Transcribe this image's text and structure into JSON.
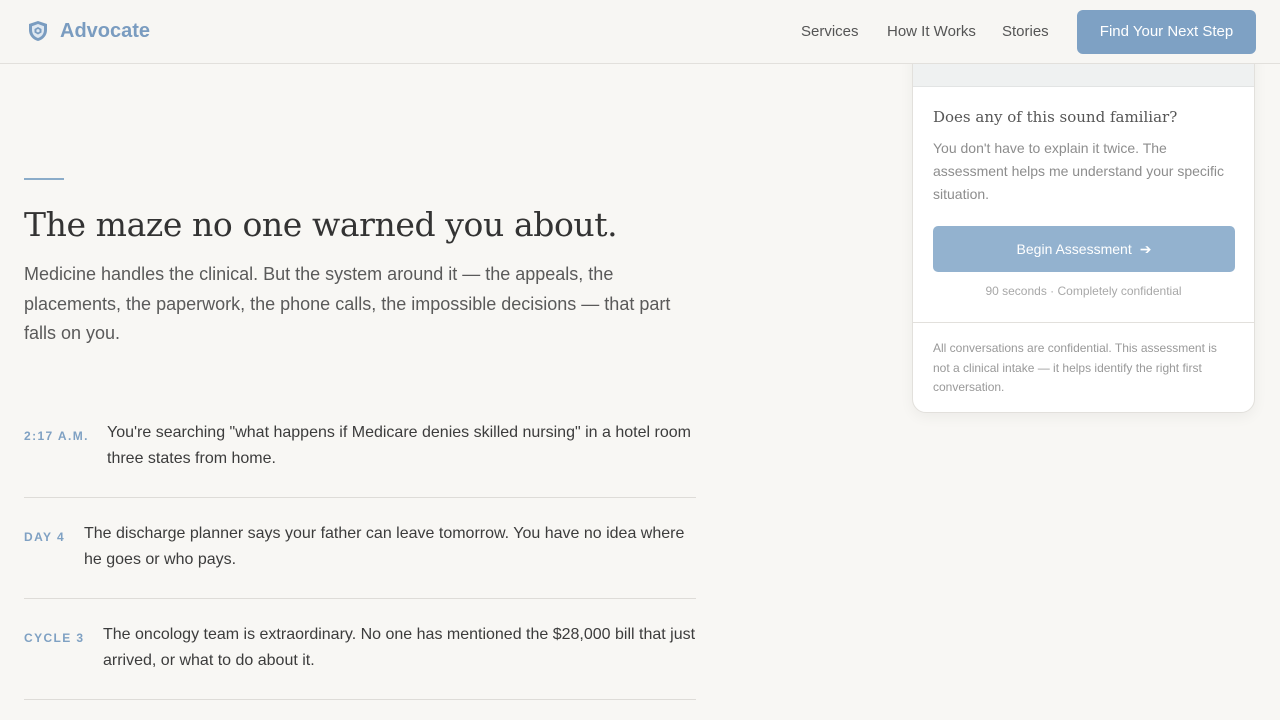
{
  "header": {
    "brand": "Advocate",
    "nav": [
      "Services",
      "How It Works",
      "Stories"
    ],
    "cta": "Find Your Next Step"
  },
  "hero": {
    "title": "The maze no one warned you about.",
    "subtitle": "Medicine handles the clinical. But the system around it — the appeals, the placements, the paperwork, the phone calls, the impossible decisions — that part falls on you."
  },
  "stories": [
    {
      "label": "2:17 A.M.",
      "text": "You're searching \"what happens if Medicare denies skilled nursing\" in a hotel room three states from home."
    },
    {
      "label": "DAY 4",
      "text": "The discharge planner says your father can leave tomorrow. You have no idea where he goes or who pays."
    },
    {
      "label": "CYCLE 3",
      "text": "The oncology team is extraordinary. No one has mentioned the $28,000 bill that just arrived, or what to do about it."
    }
  ],
  "card": {
    "question": "Does any of this sound familiar?",
    "description": "You don't have to explain it twice. The assessment helps me understand your specific situation.",
    "button": "Begin Assessment",
    "note": "90 seconds · Completely confidential",
    "footer": "All conversations are confidential. This assessment is not a clinical intake — it helps identify the right first conversation."
  },
  "colors": {
    "accent": "#7ea1c4",
    "brand": "#7a9cc0",
    "background": "#f8f7f4"
  }
}
